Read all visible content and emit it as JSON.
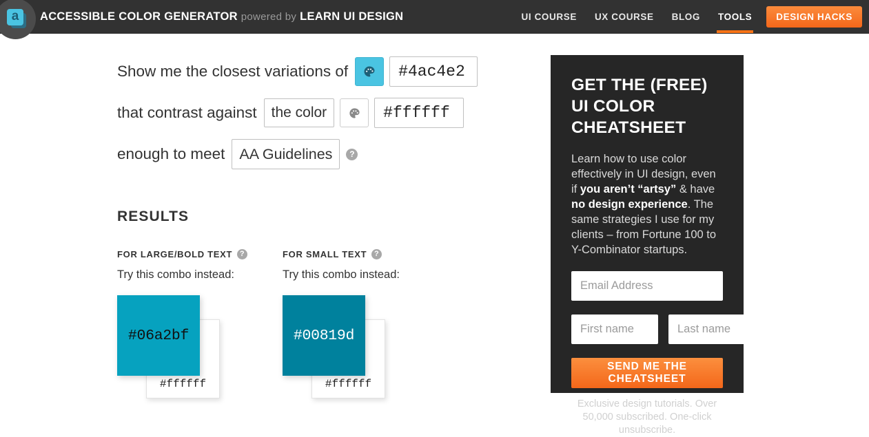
{
  "header": {
    "logo": {
      "letter": "a",
      "icon": "accessibility-logo-icon"
    },
    "brand_main": "ACCESSIBLE COLOR GENERATOR",
    "brand_mid": "powered by",
    "brand_sub": "LEARN UI DESIGN",
    "nav": [
      {
        "label": "UI COURSE",
        "active": false
      },
      {
        "label": "UX COURSE",
        "active": false
      },
      {
        "label": "BLOG",
        "active": false
      },
      {
        "label": "TOOLS",
        "active": true
      }
    ],
    "cta_label": "DESIGN HACKS",
    "accent_color": "#f4671a",
    "background_color": "#323232"
  },
  "form": {
    "line1_text": "Show me the closest variations of",
    "line1_color_value": "#4ac4e2",
    "line1_swatch_color": "#4ac4e2",
    "line2_text": "that contrast against",
    "line2_select_value": "the color",
    "line2_color_value": "#ffffff",
    "line3_text": "enough to meet",
    "line3_select_value": "AA Guidelines",
    "help_glyph": "?"
  },
  "results": {
    "title": "RESULTS",
    "columns": [
      {
        "heading": "FOR LARGE/BOLD TEXT",
        "subtext": "Try this combo instead:",
        "front_hex": "#06a2bf",
        "front_bg": "#06a2bf",
        "front_text_color": "#111111",
        "back_hex": "#ffffff"
      },
      {
        "heading": "FOR SMALL TEXT",
        "subtext": "Try this combo instead:",
        "front_hex": "#00819d",
        "front_bg": "#00819d",
        "front_text_color": "#ffffff",
        "back_hex": "#ffffff"
      }
    ]
  },
  "sidebar": {
    "title": "GET THE (FREE) UI COLOR CHEATSHEET",
    "body_1": "Learn how to use color effectively in UI design, even if ",
    "body_bold_1": "you aren’t “artsy”",
    "body_2": " & have ",
    "body_bold_2": "no design experience",
    "body_3": ". The same strategies I use for my clients – from Fortune 100 to Y-Combinator startups.",
    "email_placeholder": "Email Address",
    "first_name_placeholder": "First name",
    "last_name_placeholder": "Last name",
    "cta_label": "SEND ME THE CHEATSHEET",
    "footnote": "Exclusive design tutorials. Over 50,000 subscribed. One-click unsubscribe.",
    "background_color": "#262626"
  }
}
